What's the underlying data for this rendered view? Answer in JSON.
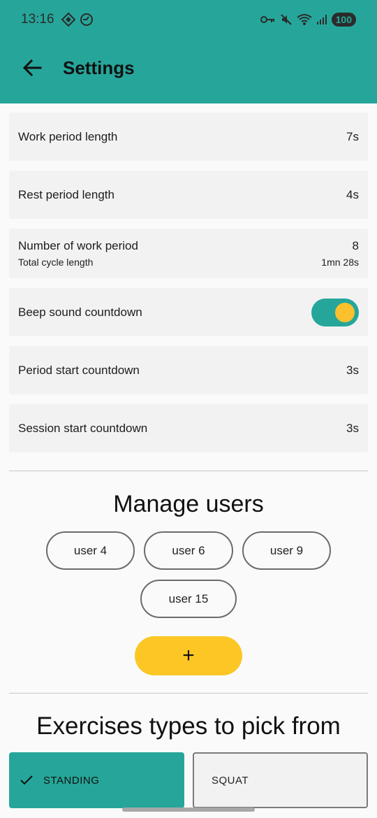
{
  "status_bar": {
    "time": "13:16",
    "battery": "100",
    "left_icons": [
      "vpn-diamond-icon",
      "timer-icon"
    ],
    "right_icons": [
      "key-icon",
      "mute-icon",
      "wifi-icon",
      "signal-icon"
    ]
  },
  "app_bar": {
    "title": "Settings",
    "back_icon": "arrow-back-icon",
    "color": "#26a69a"
  },
  "settings": {
    "work_period": {
      "label": "Work period length",
      "value": "7s"
    },
    "rest_period": {
      "label": "Rest period length",
      "value": "4s"
    },
    "num_work": {
      "label": "Number of work period",
      "value": "8",
      "sub_label": "Total cycle length",
      "sub_value": "1mn 28s"
    },
    "beep": {
      "label": "Beep sound countdown",
      "enabled": true
    },
    "period_start": {
      "label": "Period start countdown",
      "value": "3s"
    },
    "session_start": {
      "label": "Session start countdown",
      "value": "3s"
    }
  },
  "users": {
    "title": "Manage users",
    "items": [
      "user 4",
      "user 6",
      "user 9",
      "user 15"
    ],
    "add_label": "+",
    "add_color": "#fcc724"
  },
  "exercises": {
    "title": "Exercises types to pick from",
    "items": [
      {
        "label": "STANDING",
        "selected": true
      },
      {
        "label": "SQUAT",
        "selected": false
      }
    ]
  }
}
